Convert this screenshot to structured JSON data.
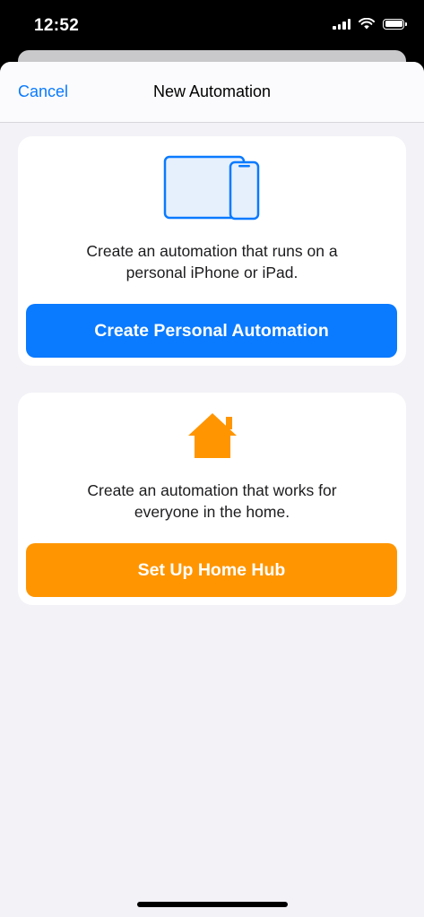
{
  "status_bar": {
    "time": "12:52"
  },
  "nav": {
    "cancel_label": "Cancel",
    "title": "New Automation"
  },
  "personal_card": {
    "icon": "iphone-ipad-icon",
    "description_line1": "Create an automation that runs on a",
    "description_line2": "personal iPhone or iPad.",
    "button_label": "Create Personal Automation",
    "button_color": "#0a7aff"
  },
  "home_card": {
    "icon": "house-icon",
    "description_line1": "Create an automation that works for",
    "description_line2": "everyone in the home.",
    "button_label": "Set Up Home Hub",
    "button_color": "#ff9500"
  },
  "colors": {
    "accent": "#0a7aff",
    "background": "#f2f2f7",
    "card": "#ffffff",
    "home": "#ff9500"
  }
}
